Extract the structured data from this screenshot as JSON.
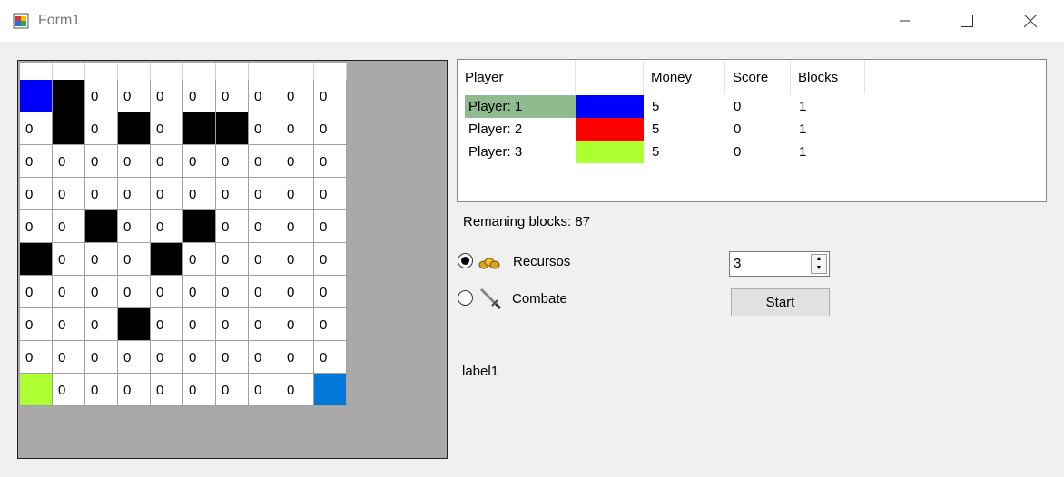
{
  "window": {
    "title": "Form1"
  },
  "grid": {
    "rows": [
      [
        "",
        "",
        "0",
        "0",
        "0",
        "0",
        "0",
        "0",
        "0",
        "0"
      ],
      [
        "0",
        "",
        "0",
        "",
        "0",
        "",
        "",
        "0",
        "0",
        "0"
      ],
      [
        "0",
        "0",
        "0",
        "0",
        "0",
        "0",
        "0",
        "0",
        "0",
        "0"
      ],
      [
        "0",
        "0",
        "0",
        "0",
        "0",
        "0",
        "0",
        "0",
        "0",
        "0"
      ],
      [
        "0",
        "0",
        "",
        "0",
        "0",
        "",
        "0",
        "0",
        "0",
        "0"
      ],
      [
        "",
        "0",
        "0",
        "0",
        "",
        "0",
        "0",
        "0",
        "0",
        "0"
      ],
      [
        "0",
        "0",
        "0",
        "0",
        "0",
        "0",
        "0",
        "0",
        "0",
        "0"
      ],
      [
        "0",
        "0",
        "0",
        "",
        "0",
        "0",
        "0",
        "0",
        "0",
        "0"
      ],
      [
        "0",
        "0",
        "0",
        "0",
        "0",
        "0",
        "0",
        "0",
        "0",
        "0"
      ],
      [
        "",
        "0",
        "0",
        "0",
        "0",
        "0",
        "0",
        "0",
        "0",
        ""
      ]
    ],
    "colors": [
      [
        "blue",
        "black",
        "",
        "",
        "",
        "",
        "",
        "",
        "",
        ""
      ],
      [
        "",
        "black",
        "",
        "black",
        "",
        "black",
        "black",
        "",
        "",
        ""
      ],
      [
        "",
        "",
        "",
        "",
        "",
        "",
        "",
        "",
        "",
        ""
      ],
      [
        "",
        "",
        "",
        "",
        "",
        "",
        "",
        "",
        "",
        ""
      ],
      [
        "",
        "",
        "black",
        "",
        "",
        "black",
        "",
        "",
        "",
        ""
      ],
      [
        "black",
        "",
        "",
        "",
        "black",
        "",
        "",
        "",
        "",
        ""
      ],
      [
        "",
        "",
        "",
        "",
        "",
        "",
        "",
        "",
        "",
        ""
      ],
      [
        "",
        "",
        "",
        "black",
        "",
        "",
        "",
        "",
        "",
        ""
      ],
      [
        "",
        "",
        "",
        "",
        "",
        "",
        "",
        "",
        "",
        ""
      ],
      [
        "green",
        "",
        "",
        "",
        "",
        "",
        "",
        "",
        "",
        "azure"
      ]
    ]
  },
  "players_table": {
    "headers": [
      "Player",
      "",
      "Money",
      "Score",
      "Blocks"
    ],
    "rows": [
      {
        "name": "Player: 1",
        "color": "#0000ff",
        "money": "5",
        "score": "0",
        "blocks": "1",
        "selected": true
      },
      {
        "name": "Player: 2",
        "color": "#ff0000",
        "money": "5",
        "score": "0",
        "blocks": "1",
        "selected": false
      },
      {
        "name": "Player: 3",
        "color": "#adff2f",
        "money": "5",
        "score": "0",
        "blocks": "1",
        "selected": false
      }
    ]
  },
  "status": {
    "remaining_blocks": "Remaning blocks: 87"
  },
  "mode": {
    "recursos_label": "Recursos",
    "combate_label": "Combate",
    "recursos_icon": "gold-coins-icon",
    "combate_icon": "sword-icon",
    "selected": "Recursos"
  },
  "controls": {
    "count_value": "3",
    "start_label": "Start"
  },
  "label1": "label1",
  "colors": {
    "selected_row": "#8fbc8f",
    "panel_bg": "#a9a9a9",
    "window_bg": "#f0f0f0"
  }
}
